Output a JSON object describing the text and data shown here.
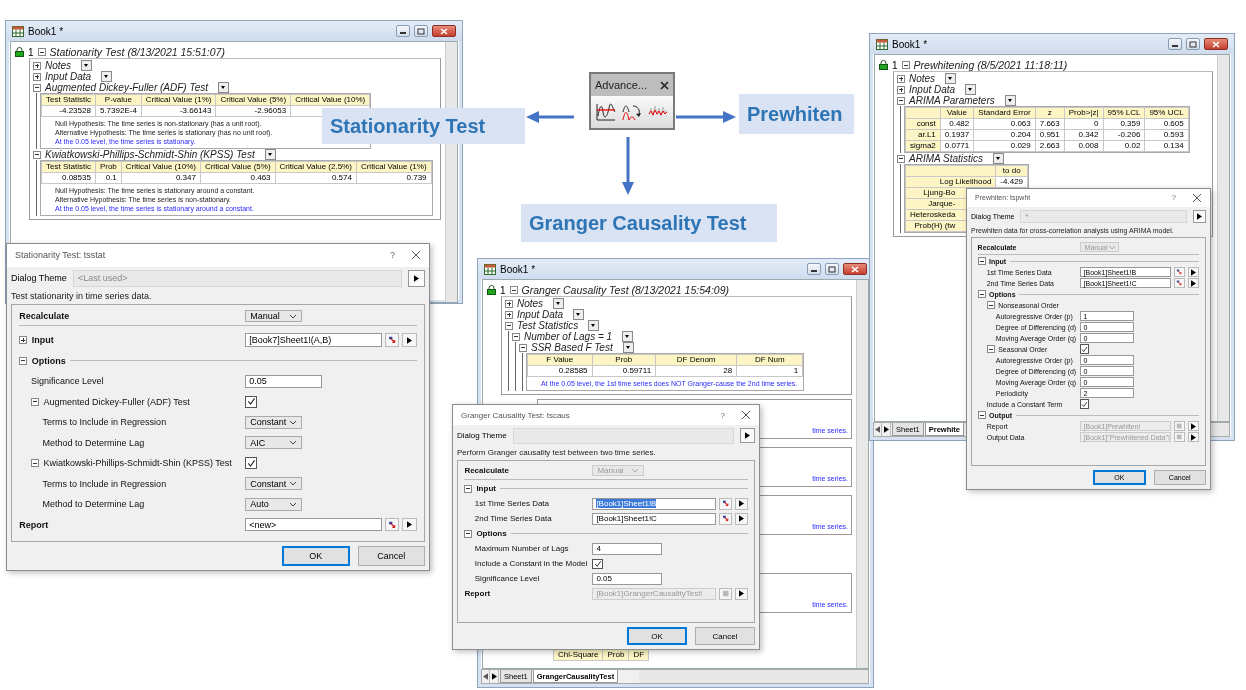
{
  "workbooks": [
    {
      "title": "Book1 *",
      "report": {
        "index": "1",
        "title": "Stationarity Test (8/13/2021 15:51:07)",
        "expanded": true,
        "children": [
          {
            "label": "Notes",
            "expanded": false
          },
          {
            "label": "Input Data",
            "expanded": false
          },
          {
            "label": "Augmented Dickey-Fuller (ADF) Test",
            "expanded": true,
            "table": {
              "columns": [
                "Test Statistic",
                "P-value",
                "Critical Value (1%)",
                "Critical Value (5%)",
                "Critical Value (10%)"
              ],
              "rows": [
                {
                  "cells": [
                    "-4.23528",
                    "5.7392E-4",
                    "-3.66143",
                    "-2.96053"
                  ]
                }
              ]
            },
            "notes": [
              {
                "kind": "plain",
                "text": "Null Hypothesis: The time series is non-stationary (has a unit root)."
              },
              {
                "kind": "plain",
                "text": "Alternative Hypothesis: The time series is stationary (has no unit root)."
              },
              {
                "kind": "conclusion",
                "text": "At the 0.05 level, the time series is stationary."
              }
            ]
          },
          {
            "label": "Kwiatkowski-Phillips-Schmidt-Shin (KPSS) Test",
            "expanded": true,
            "table": {
              "columns": [
                "Test Statistic",
                "Prob",
                "Critical Value (10%)",
                "Critical Value (5%)",
                "Critical Value (2.5%)",
                "Critical Value (1%)"
              ],
              "rows": [
                {
                  "cells": [
                    "0.08535",
                    "0.1",
                    "0.347",
                    "0.463",
                    "0.574",
                    "0.739"
                  ]
                }
              ]
            },
            "notes": [
              {
                "kind": "plain",
                "text": "Null Hypothesis: The time series is stationary around a constant."
              },
              {
                "kind": "plain",
                "text": "Alternative Hypothesis: The time series is non-stationary."
              },
              {
                "kind": "conclusion",
                "text": "At the 0.05 level, the time series is stationary around a constant."
              }
            ]
          }
        ]
      }
    },
    {
      "title": "Book1 *",
      "report": {
        "index": "1",
        "title": "Granger Causality Test (8/13/2021 15:54:09)",
        "expanded": true,
        "children": [
          {
            "label": "Notes",
            "expanded": false
          },
          {
            "label": "Input Data",
            "expanded": false
          },
          {
            "label": "Test Statistics",
            "expanded": true,
            "children": [
              {
                "label": "Number of Lags = 1",
                "expanded": true,
                "children": [
                  {
                    "label": "SSR Based F Test",
                    "expanded": true,
                    "table": {
                      "columns": [
                        "F Value",
                        "Prob",
                        "DF Denom",
                        "DF Num"
                      ],
                      "rows": [
                        {
                          "cells": [
                            "0.28585",
                            "0.59711",
                            "28",
                            "1"
                          ]
                        }
                      ]
                    },
                    "notes": [
                      {
                        "kind": "conclusion",
                        "text": "At the 0.05 level, the 1st time series does NOT Granger-cause the 2nd time series."
                      }
                    ]
                  }
                ]
              }
            ]
          }
        ]
      },
      "covered_conclusions": [
        {
          "text": "time series."
        },
        {
          "text": "time series."
        },
        {
          "text": "time series."
        },
        {
          "text": "time series."
        }
      ],
      "lower_table": {
        "columns": [
          "Chi-Square",
          "Prob",
          "DF"
        ]
      },
      "tabs": [
        {
          "label": "Sheet1",
          "selected": false
        },
        {
          "label": "GrangerCausalityTest",
          "selected": true
        }
      ]
    },
    {
      "title": "Book1 *",
      "report": {
        "index": "1",
        "title": "Prewhitening (8/5/2021 11:18:11)",
        "expanded": true,
        "children": [
          {
            "label": "Notes",
            "expanded": false
          },
          {
            "label": "Input Data",
            "expanded": false
          },
          {
            "label": "ARIMA Parameters",
            "expanded": true,
            "table": {
              "columns": [
                "Value",
                "Standard Error",
                "z",
                "Prob>|z|",
                "95% LCL",
                "95% UCL"
              ],
              "rows": [
                {
                  "label": "const",
                  "cells": [
                    "0.482",
                    "0.063",
                    "7.663",
                    "0",
                    "0.359",
                    "0.605"
                  ]
                },
                {
                  "label": "ar.L1",
                  "cells": [
                    "0.1937",
                    "0.204",
                    "0.951",
                    "0.342",
                    "-0.206",
                    "0.593"
                  ]
                },
                {
                  "label": "sigma2",
                  "cells": [
                    "0.0771",
                    "0.029",
                    "2.663",
                    "0.008",
                    "0.02",
                    "0.134"
                  ]
                }
              ]
            }
          },
          {
            "label": "ARIMA Statistics",
            "expanded": true,
            "table": {
              "columns": [
                "to do"
              ],
              "rows": [
                {
                  "label": "Log Likelihood",
                  "cells": [
                    "-4.429"
                  ]
                },
                {
                  "label": "Ljung-Bo"
                },
                {
                  "label": "Jarque-"
                },
                {
                  "label": "Heteroskeda"
                },
                {
                  "label": "Prob(H) (tw"
                }
              ]
            }
          }
        ]
      },
      "tabs": [
        {
          "label": "Sheet1",
          "selected": false
        },
        {
          "label": "Prewhite",
          "selected": true
        }
      ]
    }
  ],
  "dialogs": [
    {
      "title": "Stationarity Test: tsstat",
      "help": "?",
      "theme_label": "Dialog Theme",
      "theme_value": "<Last used>",
      "description": "Test stationarity in time series data.",
      "rows": [
        {
          "kind": "dropdown",
          "label": "Recalculate",
          "value": "Manual",
          "disabled": false
        },
        {
          "kind": "section",
          "label": "Input",
          "expanded": false,
          "value": "[Book7]Sheet1!(A,B)"
        },
        {
          "kind": "section",
          "label": "Options",
          "expanded": true,
          "children": [
            {
              "kind": "text",
              "label": "Significance Level",
              "value": "0.05"
            },
            {
              "kind": "section",
              "label": "Augmented Dickey-Fuller (ADF) Test",
              "expanded": true,
              "checked": true,
              "children": [
                {
                  "kind": "dropdown",
                  "label": "Terms to Include in Regression",
                  "value": "Constant",
                  "disabled": false
                },
                {
                  "kind": "dropdown",
                  "label": "Method to Determine Lag",
                  "value": "AIC",
                  "disabled": false
                }
              ]
            },
            {
              "kind": "section",
              "label": "Kwiatkowski-Phillips-Schmidt-Shin (KPSS) Test",
              "expanded": true,
              "checked": true,
              "children": [
                {
                  "kind": "dropdown",
                  "label": "Terms to Include in Regression",
                  "value": "Constant",
                  "disabled": false
                },
                {
                  "kind": "dropdown",
                  "label": "Method to Determine Lag",
                  "value": "Auto",
                  "disabled": false
                }
              ]
            }
          ]
        },
        {
          "kind": "picker",
          "label": "Report",
          "value": "<new>",
          "disabled": false
        }
      ],
      "buttons": [
        {
          "label": "OK",
          "default": true
        },
        {
          "label": "Cancel",
          "default": false
        }
      ]
    },
    {
      "title": "Granger Causality Test: tscaus",
      "help": "?",
      "theme_label": "Dialog Theme",
      "description": "Perform Granger causality test between two time series.",
      "rows": [
        {
          "kind": "dropdown",
          "label": "Recalculate",
          "value": "Manual",
          "disabled": true
        },
        {
          "kind": "section",
          "label": "Input",
          "expanded": true,
          "children": [
            {
              "kind": "picker",
              "label": "1st Time Series Data",
              "value": "[Book1]Sheet1!B",
              "disabled": false,
              "highlighted": true
            },
            {
              "kind": "picker",
              "label": "2nd Time Series Data",
              "value": "[Book1]Sheet1!C",
              "disabled": false,
              "highlighted": false
            }
          ]
        },
        {
          "kind": "section",
          "label": "Options",
          "expanded": true,
          "children": [
            {
              "kind": "text",
              "label": "Maximum Number of Lags",
              "value": "4"
            },
            {
              "kind": "checkbox",
              "label": "Include a Constant in the Model",
              "checked": true
            },
            {
              "kind": "text",
              "label": "Significance Level",
              "value": "0.05"
            }
          ]
        },
        {
          "kind": "picker",
          "label": "Report",
          "value": "[Book1]GrangerCausalityTest!",
          "disabled": true
        }
      ],
      "buttons": [
        {
          "label": "OK",
          "default": true
        },
        {
          "label": "Cancel",
          "default": false
        }
      ]
    },
    {
      "title": "Prewhiten: tspwht",
      "help": "?",
      "theme_label": "Dialog Theme",
      "theme_value": "*",
      "description": "Prewhiten data for cross-correlation analysis using ARIMA model.",
      "rows": [
        {
          "kind": "dropdown",
          "label": "Recalculate",
          "value": "Manual",
          "disabled": true
        },
        {
          "kind": "section",
          "label": "Input",
          "expanded": true,
          "children": [
            {
              "kind": "picker",
              "label": "1st Time Series Data",
              "value": "[Book1]Sheet1!B",
              "disabled": false
            },
            {
              "kind": "picker",
              "label": "2nd Time Series Data",
              "value": "[Book1]Sheet1!C",
              "disabled": false
            }
          ]
        },
        {
          "kind": "section",
          "label": "Options",
          "expanded": true,
          "children": [
            {
              "kind": "section",
              "label": "Nonseasonal Order",
              "expanded": true,
              "children": [
                {
                  "kind": "text",
                  "label": "Autoregressive Order (p)",
                  "value": "1"
                },
                {
                  "kind": "text",
                  "label": "Degree of Differencing (d)",
                  "value": "0"
                },
                {
                  "kind": "text",
                  "label": "Moving Average Order (q)",
                  "value": "0"
                }
              ]
            },
            {
              "kind": "section",
              "label": "Seasonal Order",
              "expanded": true,
              "checked": true,
              "children": [
                {
                  "kind": "text",
                  "label": "Autoregressive Order (p)",
                  "value": "0"
                },
                {
                  "kind": "text",
                  "label": "Degree of Differencing (d)",
                  "value": "0"
                },
                {
                  "kind": "text",
                  "label": "Moving Average Order (q)",
                  "value": "0"
                },
                {
                  "kind": "text",
                  "label": "Periodicity",
                  "value": "2"
                }
              ]
            },
            {
              "kind": "checkbox",
              "label": "Include a Constant Term",
              "checked": true
            }
          ]
        },
        {
          "kind": "section",
          "label": "Output",
          "expanded": true,
          "children": [
            {
              "kind": "picker",
              "label": "Report",
              "value": "[Book1]Prewhiten!",
              "disabled": true
            },
            {
              "kind": "picker",
              "label": "Output Data",
              "value": "[Book1]\"Prewhitened Data\"!",
              "disabled": true
            }
          ]
        }
      ],
      "buttons": [
        {
          "label": "OK",
          "default": true
        },
        {
          "label": "Cancel",
          "default": false
        }
      ]
    }
  ],
  "toolbar": {
    "title": "Advance..."
  },
  "callouts": [
    {
      "text": "Stationarity Test"
    },
    {
      "text": "Prewhiten"
    },
    {
      "text": "Granger Causality Test"
    }
  ]
}
